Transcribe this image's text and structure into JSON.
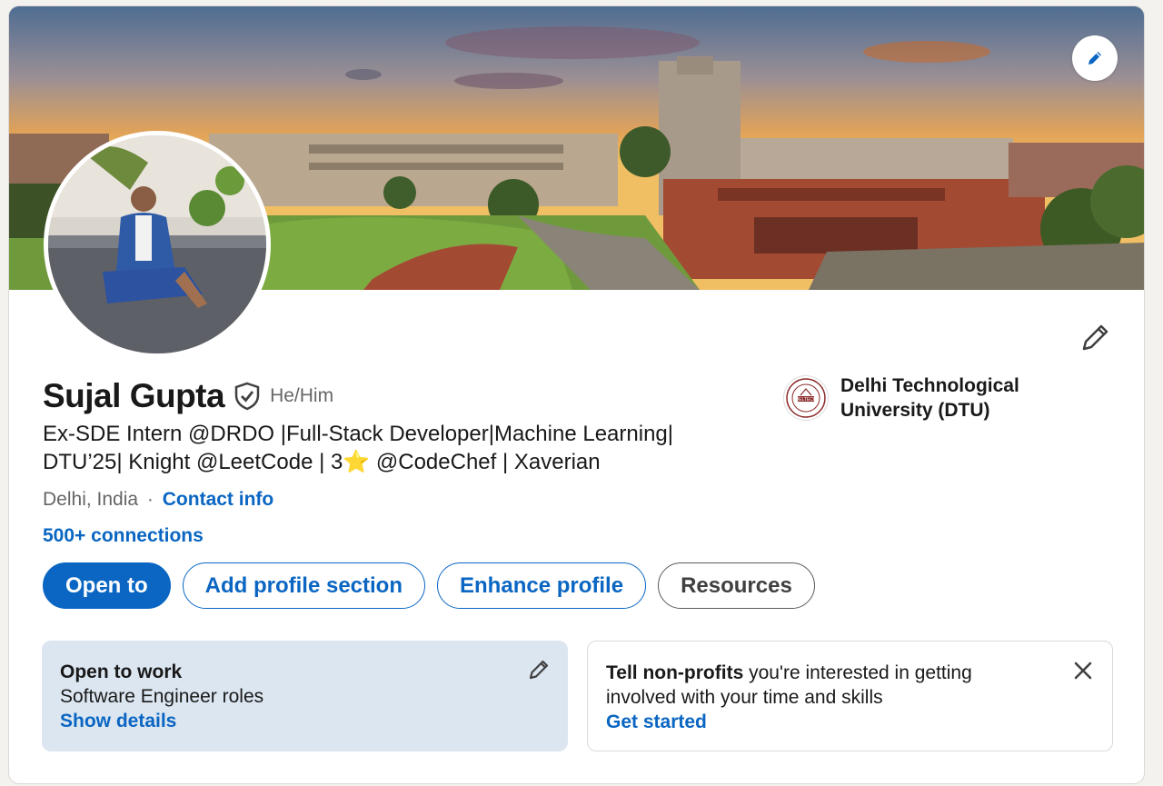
{
  "profile": {
    "name": "Sujal Gupta",
    "pronouns": "He/Him",
    "headline": "Ex-SDE Intern @DRDO |Full-Stack Developer|Machine Learning| DTU’25| Knight @LeetCode | 3⭐️ @CodeChef | Xaverian",
    "location": "Delhi, India",
    "separator": "·",
    "contact_label": "Contact info",
    "connections": "500+ connections"
  },
  "education": {
    "name": "Delhi Technological University (DTU)",
    "logo_text": "DELTECH"
  },
  "actions": {
    "open_to": "Open to",
    "add_section": "Add profile section",
    "enhance": "Enhance profile",
    "resources": "Resources"
  },
  "open_to_work": {
    "title": "Open to work",
    "roles": "Software Engineer roles",
    "link": "Show details"
  },
  "nonprofits": {
    "bold": "Tell non-profits",
    "text": " you're interested in getting involved with your time and skills",
    "link": "Get started"
  },
  "colors": {
    "brand": "#0a66c2",
    "open_to_work_bg": "#dce6f1",
    "page_bg": "#f4f2ee"
  },
  "icons": {
    "banner_edit": "pencil-icon",
    "intro_edit": "pencil-icon",
    "verified": "shield-check-icon",
    "open_to_work_edit": "pencil-icon",
    "dismiss": "close-icon"
  }
}
